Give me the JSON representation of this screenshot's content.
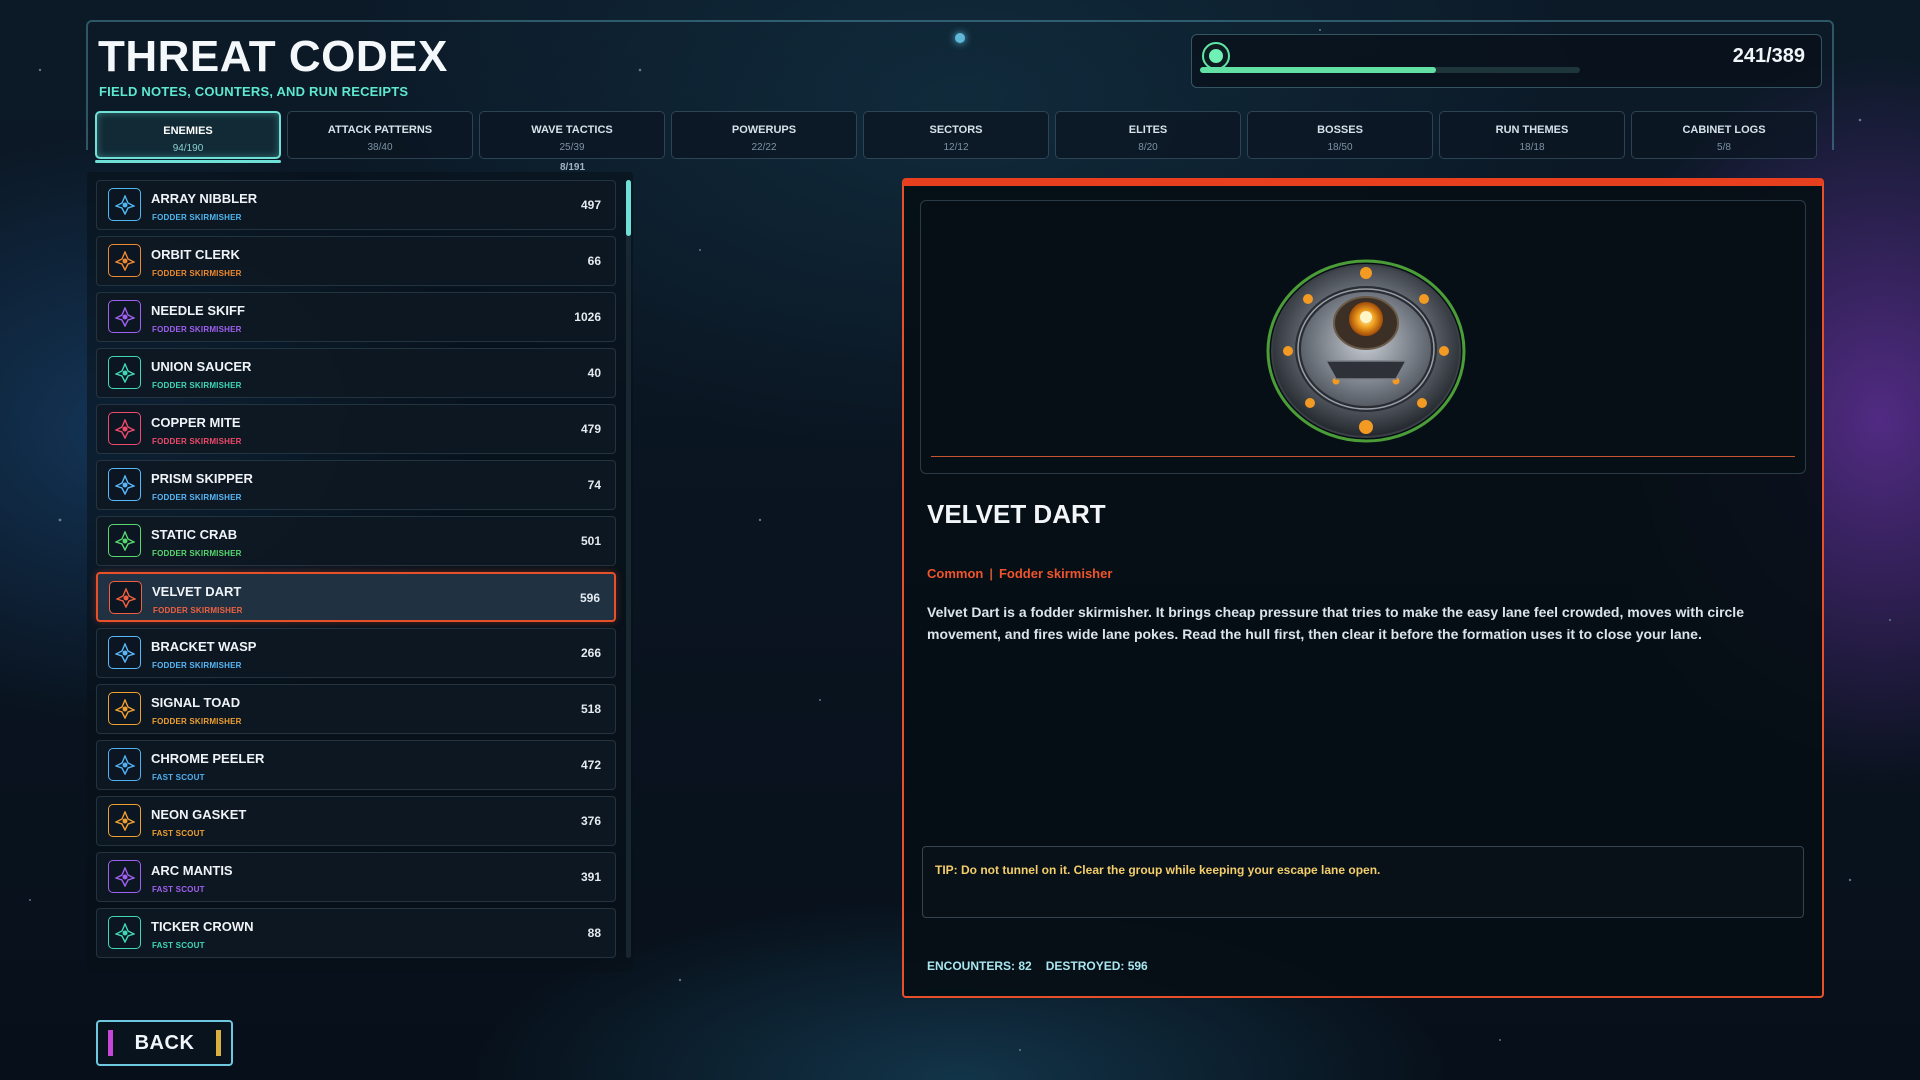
{
  "header": {
    "title": "THREAT CODEX",
    "subtitle": "FIELD NOTES, COUNTERS, AND RUN RECEIPTS",
    "progress_text": "241/389",
    "progress_fraction": 0.62
  },
  "tabs": [
    {
      "label": "ENEMIES",
      "count": "94/190",
      "active": true
    },
    {
      "label": "ATTACK PATTERNS",
      "count": "38/40",
      "active": false
    },
    {
      "label": "WAVE TACTICS",
      "count": "25/39",
      "active": false
    },
    {
      "label": "POWERUPS",
      "count": "22/22",
      "active": false
    },
    {
      "label": "SECTORS",
      "count": "12/12",
      "active": false
    },
    {
      "label": "ELITES",
      "count": "8/20",
      "active": false
    },
    {
      "label": "BOSSES",
      "count": "18/50",
      "active": false
    },
    {
      "label": "RUN THEMES",
      "count": "18/18",
      "active": false
    },
    {
      "label": "CABINET LOGS",
      "count": "5/8",
      "active": false
    }
  ],
  "list_counter": "8/191",
  "scroll_fraction": 0.0,
  "enemies": [
    {
      "name": "ARRAY NIBBLER",
      "type": "FODDER SKIRMISHER",
      "count": "497",
      "color": "#4fb8f0",
      "icon": "ship-icon"
    },
    {
      "name": "ORBIT CLERK",
      "type": "FODDER SKIRMISHER",
      "count": "66",
      "color": "#f08a30",
      "icon": "ship-icon"
    },
    {
      "name": "NEEDLE SKIFF",
      "type": "FODDER SKIRMISHER",
      "count": "1026",
      "color": "#a060f0",
      "icon": "ship-icon"
    },
    {
      "name": "UNION SAUCER",
      "type": "FODDER SKIRMISHER",
      "count": "40",
      "color": "#40d8b8",
      "icon": "ship-icon"
    },
    {
      "name": "COPPER MITE",
      "type": "FODDER SKIRMISHER",
      "count": "479",
      "color": "#f04a6a",
      "icon": "ship-icon"
    },
    {
      "name": "PRISM SKIPPER",
      "type": "FODDER SKIRMISHER",
      "count": "74",
      "color": "#58b8f8",
      "icon": "ship-icon"
    },
    {
      "name": "STATIC CRAB",
      "type": "FODDER SKIRMISHER",
      "count": "501",
      "color": "#58d870",
      "icon": "ship-icon"
    },
    {
      "name": "VELVET DART",
      "type": "FODDER SKIRMISHER",
      "count": "596",
      "color": "#f06040",
      "icon": "ship-icon",
      "selected": true
    },
    {
      "name": "BRACKET WASP",
      "type": "FODDER SKIRMISHER",
      "count": "266",
      "color": "#58b8f8",
      "icon": "ship-icon"
    },
    {
      "name": "SIGNAL TOAD",
      "type": "FODDER SKIRMISHER",
      "count": "518",
      "color": "#f0a030",
      "icon": "ship-icon"
    },
    {
      "name": "CHROME PEELER",
      "type": "FAST SCOUT",
      "count": "472",
      "color": "#50b0f0",
      "icon": "ship-icon"
    },
    {
      "name": "NEON GASKET",
      "type": "FAST SCOUT",
      "count": "376",
      "color": "#f0a030",
      "icon": "ship-icon"
    },
    {
      "name": "ARC MANTIS",
      "type": "FAST SCOUT",
      "count": "391",
      "color": "#a060f0",
      "icon": "ship-icon"
    },
    {
      "name": "TICKER CROWN",
      "type": "FAST SCOUT",
      "count": "88",
      "color": "#40d8b8",
      "icon": "ship-icon"
    }
  ],
  "detail": {
    "name": "VELVET DART",
    "rarity": "Common",
    "separator": "|",
    "type": "Fodder skirmisher",
    "description": "Velvet Dart is a fodder skirmisher. It brings cheap pressure that tries to make the easy lane feel crowded, moves with circle movement, and fires wide lane pokes. Read the hull first, then clear it before the formation uses it to close your lane.",
    "tip": "TIP: Do not tunnel on it. Clear the group while keeping your escape lane open.",
    "encounters": "ENCOUNTERS: 82",
    "destroyed": "DESTROYED: 596"
  },
  "back_button": "BACK",
  "colors": {
    "accent": "#6ee0d8",
    "selection": "#e8502a",
    "progress": "#63e0a4",
    "tip": "#f4ce6a"
  }
}
